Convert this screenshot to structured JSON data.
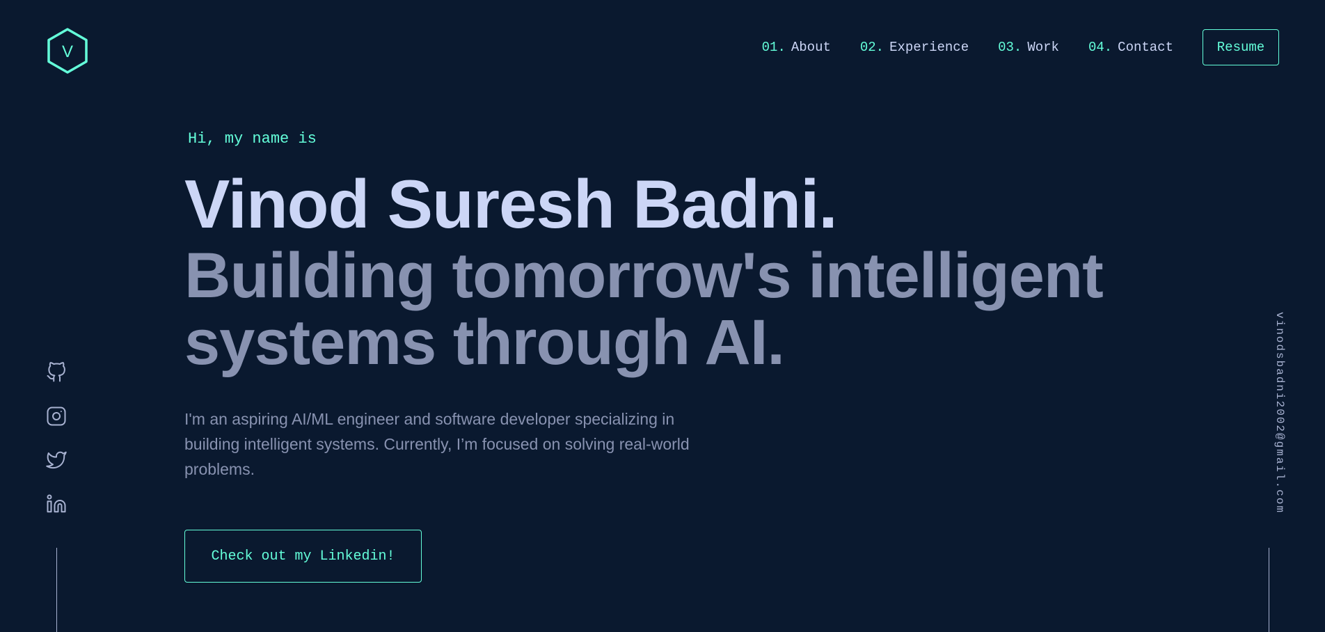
{
  "colors": {
    "background": "#0a192f",
    "accent": "#64ffda",
    "heading": "#ccd6f6",
    "text": "#8892b0",
    "muted": "#a8b2d1"
  },
  "logo": {
    "letter": "V",
    "icon": "hexagon-logo-icon"
  },
  "nav": {
    "items": [
      {
        "num": "01.",
        "label": "About"
      },
      {
        "num": "02.",
        "label": "Experience"
      },
      {
        "num": "03.",
        "label": "Work"
      },
      {
        "num": "04.",
        "label": "Contact"
      }
    ],
    "resume_label": "Resume"
  },
  "social": [
    {
      "icon": "github-icon"
    },
    {
      "icon": "instagram-icon"
    },
    {
      "icon": "twitter-icon"
    },
    {
      "icon": "linkedin-icon"
    }
  ],
  "email": "vinodsbadni2002@gmail.com",
  "hero": {
    "greeting": "Hi, my name is",
    "name": "Vinod Suresh Badni.",
    "tagline": "Building tomorrow's intelligent systems through AI.",
    "intro": "I'm an aspiring AI/ML engineer and software developer specializing in building intelligent systems. Currently, I’m focused on solving real-world problems.",
    "cta_label": "Check out my Linkedin!"
  }
}
